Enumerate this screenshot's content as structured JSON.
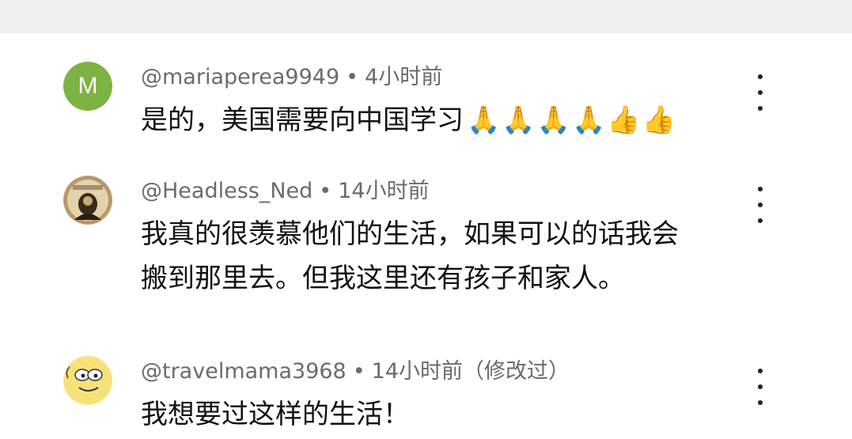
{
  "comments": [
    {
      "avatar_letter": "M",
      "avatar_color": "#7cb342",
      "username": "@mariaperea9949",
      "time": "4小时前",
      "text": "是的，美国需要向中国学习",
      "emoji": "🙏🙏🙏🙏👍👍"
    },
    {
      "avatar_icon": "sepia-portrait-avatar",
      "username": "@Headless_Ned",
      "time": "14小时前",
      "text": "我真的很羡慕他们的生活，如果可以的话我会\n搬到那里去。但我这里还有孩子和家人。"
    },
    {
      "avatar_icon": "cartoon-character-avatar",
      "username": "@travelmama3968",
      "time": "14小时前（修改过）",
      "text": "我想要过这样的生活！"
    }
  ],
  "meta_separator": "•"
}
